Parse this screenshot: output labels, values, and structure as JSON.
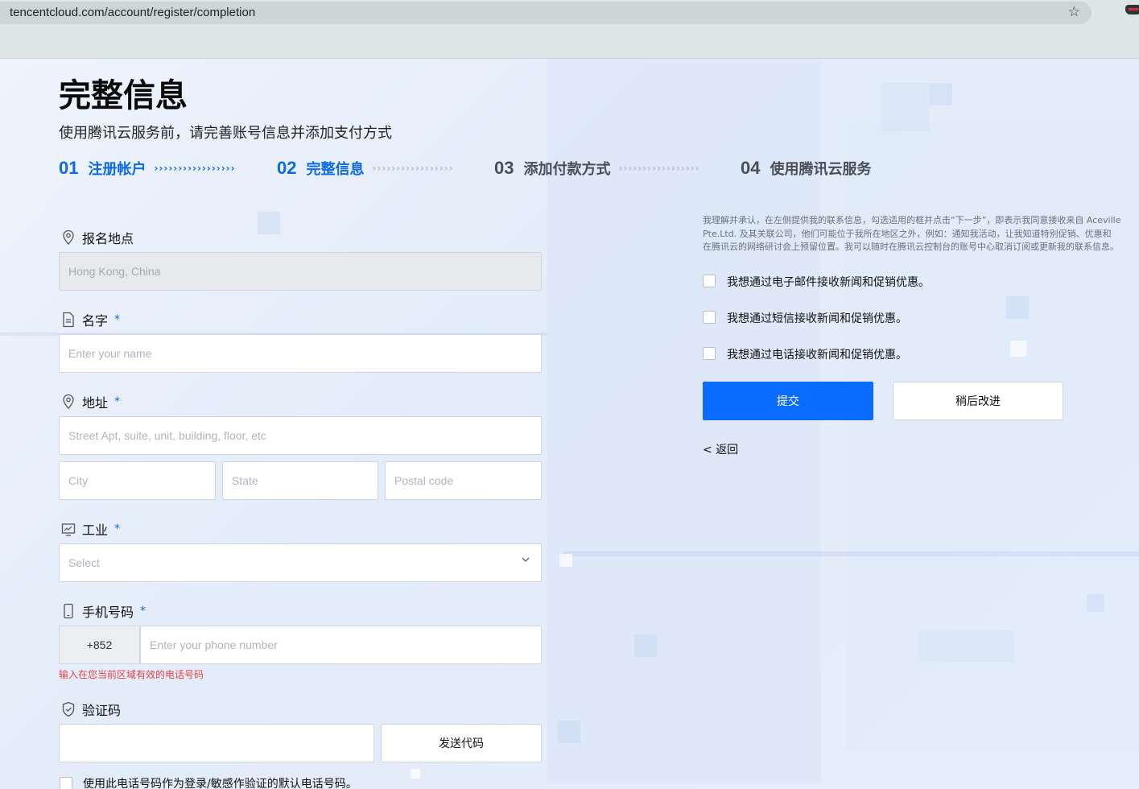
{
  "browser": {
    "url": "tencentcloud.com/account/register/completion"
  },
  "page": {
    "title": "完整信息",
    "subtitle": "使用腾讯云服务前，请完善账号信息并添加支付方式"
  },
  "steps": [
    {
      "num": "01",
      "label": "注册帐户",
      "status": "done"
    },
    {
      "num": "02",
      "label": "完整信息",
      "status": "current"
    },
    {
      "num": "03",
      "label": "添加付款方式",
      "status": "pending"
    },
    {
      "num": "04",
      "label": "使用腾讯云服务",
      "status": "pending"
    }
  ],
  "form": {
    "location": {
      "label": "报名地点",
      "value": "Hong Kong, China"
    },
    "name": {
      "label": "名字",
      "required": "*",
      "placeholder": "Enter your name"
    },
    "address": {
      "label": "地址",
      "required": "*",
      "street_placeholder": "Street Apt, suite, unit, building, floor, etc",
      "city_placeholder": "City",
      "state_placeholder": "State",
      "postal_placeholder": "Postal code"
    },
    "industry": {
      "label": "工业",
      "required": "*",
      "placeholder": "Select"
    },
    "phone": {
      "label": "手机号码",
      "required": "*",
      "prefix": "+852",
      "placeholder": "Enter your phone number",
      "error": "输入在您当前区域有效的电话号码"
    },
    "verification": {
      "label": "验证码",
      "send_button": "发送代码"
    },
    "default_phone_checkbox": "使用此电话号码作为登录/敏感作验证的默认电话号码。"
  },
  "consent": {
    "lines": [
      "我理解并承认，在左侧提供我的联系信息，勾选适用的框并点击“下一步”，即表示我同意接收来自 Aceville",
      "Pte.Ltd. 及其关联公司，他们可能位于我所在地区之外，例如：通知我活动，让我知道特别促销、优惠和",
      "在腾讯云的网络研讨会上预留位置。我可以随时在腾讯云控制台的账号中心取消订阅或更新我的联系信息。"
    ],
    "options": [
      "我想通过电子邮件接收新闻和促销优惠。",
      "我想通过短信接收新闻和促销优惠。",
      "我想通过电话接收新闻和促销优惠。"
    ],
    "submit_label": "提交",
    "later_label": "稍后改进",
    "back_label": "< 返回"
  },
  "colors": {
    "accent": "#0a6cff",
    "step_active": "#0d6ae6",
    "error": "#e54545"
  }
}
